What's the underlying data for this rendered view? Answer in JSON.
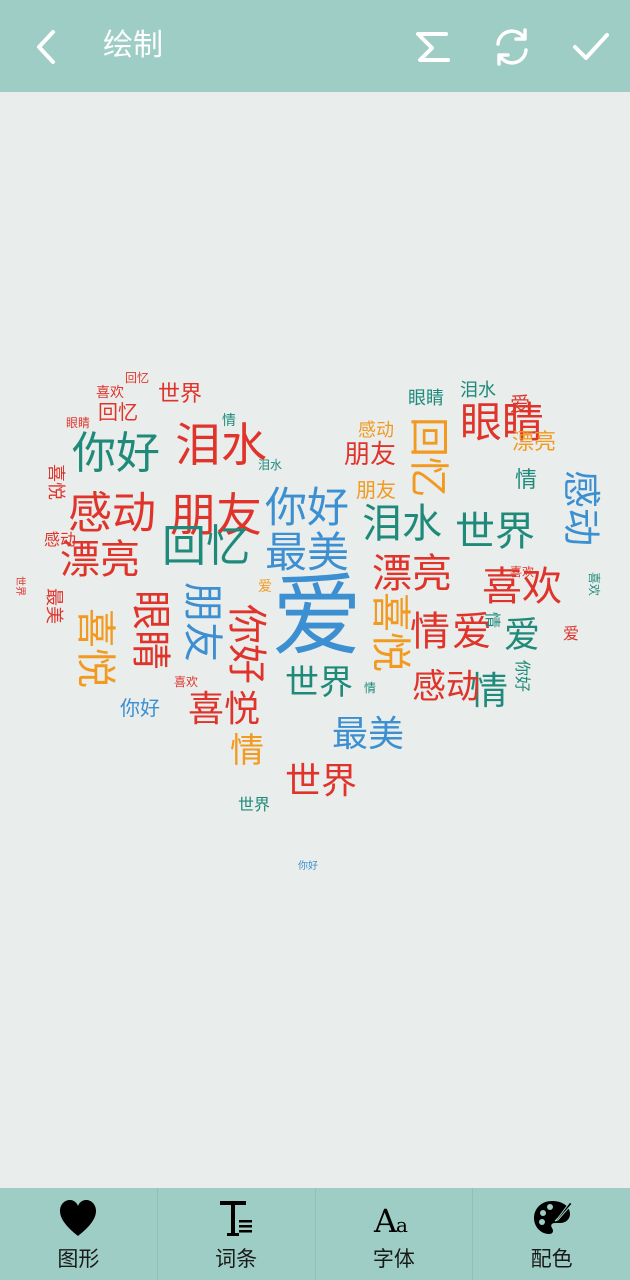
{
  "header": {
    "title": "绘制"
  },
  "colors": {
    "bar": "#9dcdc4",
    "canvas": "#e9edec",
    "palette": [
      "#e0342b",
      "#f29a1f",
      "#3c8fd1",
      "#1f8a7a",
      "#e84c2d"
    ]
  },
  "word_cloud": {
    "words": [
      {
        "text": "爱",
        "color": "#3c8fd1",
        "size": 90
      },
      {
        "text": "朋友",
        "color": "#e0342b",
        "size": 46
      },
      {
        "text": "你好",
        "color": "#3c8fd1",
        "size": 42
      },
      {
        "text": "泪水",
        "color": "#e0342b",
        "size": 46
      },
      {
        "text": "你好",
        "color": "#1f8a7a",
        "size": 44
      },
      {
        "text": "感动",
        "color": "#e0342b",
        "size": 44
      },
      {
        "text": "回忆",
        "color": "#1f8a7a",
        "size": 44
      },
      {
        "text": "最美",
        "color": "#3c8fd1",
        "size": 42
      },
      {
        "text": "漂亮",
        "color": "#e0342b",
        "size": 40
      },
      {
        "text": "世界",
        "color": "#1f8a7a",
        "size": 40
      },
      {
        "text": "泪水",
        "color": "#1f8a7a",
        "size": 40
      },
      {
        "text": "眼睛",
        "color": "#e0342b",
        "size": 42
      },
      {
        "text": "回忆",
        "color": "#f29a1f",
        "size": 40
      },
      {
        "text": "漂亮",
        "color": "#e0342b",
        "size": 40
      },
      {
        "text": "喜欢",
        "color": "#e0342b",
        "size": 40
      },
      {
        "text": "感动",
        "color": "#3c8fd1",
        "size": 38
      },
      {
        "text": "情",
        "color": "#e0342b",
        "size": 40
      },
      {
        "text": "爱",
        "color": "#e0342b",
        "size": 40
      },
      {
        "text": "爱",
        "color": "#1f8a7a",
        "size": 36
      },
      {
        "text": "喜悦",
        "color": "#f29a1f",
        "size": 40
      },
      {
        "text": "眼睛",
        "color": "#e0342b",
        "size": 40
      },
      {
        "text": "朋友",
        "color": "#3c8fd1",
        "size": 40
      },
      {
        "text": "你好",
        "color": "#e0342b",
        "size": 40
      },
      {
        "text": "喜悦",
        "color": "#f29a1f",
        "size": 40
      },
      {
        "text": "情",
        "color": "#1f8a7a",
        "size": 38
      },
      {
        "text": "感动",
        "color": "#e0342b",
        "size": 34
      },
      {
        "text": "世界",
        "color": "#1f8a7a",
        "size": 34
      },
      {
        "text": "最美",
        "color": "#3c8fd1",
        "size": 36
      },
      {
        "text": "喜悦",
        "color": "#e0342b",
        "size": 36
      },
      {
        "text": "情",
        "color": "#f29a1f",
        "size": 34
      },
      {
        "text": "世界",
        "color": "#e0342b",
        "size": 36
      },
      {
        "text": "朋友",
        "color": "#e0342b",
        "size": 26
      },
      {
        "text": "感动",
        "color": "#f29a1f",
        "size": 18
      },
      {
        "text": "漂亮",
        "color": "#f29a1f",
        "size": 22
      },
      {
        "text": "情",
        "color": "#1f8a7a",
        "size": 22
      },
      {
        "text": "朋友",
        "color": "#f29a1f",
        "size": 20
      },
      {
        "text": "眼睛",
        "color": "#1f8a7a",
        "size": 18
      },
      {
        "text": "泪水",
        "color": "#1f8a7a",
        "size": 18
      },
      {
        "text": "爱",
        "color": "#e0342b",
        "size": 20
      },
      {
        "text": "回忆",
        "color": "#e0342b",
        "size": 20
      },
      {
        "text": "世界",
        "color": "#e0342b",
        "size": 22
      },
      {
        "text": "喜欢",
        "color": "#e0342b",
        "size": 14
      },
      {
        "text": "回忆",
        "color": "#e0342b",
        "size": 12
      },
      {
        "text": "眼睛",
        "color": "#e0342b",
        "size": 12
      },
      {
        "text": "情",
        "color": "#1f8a7a",
        "size": 14
      },
      {
        "text": "泪水",
        "color": "#1f8a7a",
        "size": 12
      },
      {
        "text": "喜悦",
        "color": "#e0342b",
        "size": 18
      },
      {
        "text": "最美",
        "color": "#e0342b",
        "size": 18
      },
      {
        "text": "你好",
        "color": "#3c8fd1",
        "size": 20
      },
      {
        "text": "喜欢",
        "color": "#e0342b",
        "size": 12
      },
      {
        "text": "情",
        "color": "#1f8a7a",
        "size": 12
      },
      {
        "text": "世界",
        "color": "#1f8a7a",
        "size": 16
      },
      {
        "text": "你好",
        "color": "#3c8fd1",
        "size": 10
      },
      {
        "text": "感动",
        "color": "#e0342b",
        "size": 16
      },
      {
        "text": "喜欢",
        "color": "#e0342b",
        "size": 12
      },
      {
        "text": "喜欢",
        "color": "#1f8a7a",
        "size": 12
      },
      {
        "text": "爱",
        "color": "#f29a1f",
        "size": 14
      },
      {
        "text": "情",
        "color": "#1f8a7a",
        "size": 16
      },
      {
        "text": "你好",
        "color": "#1f8a7a",
        "size": 16
      },
      {
        "text": "爱",
        "color": "#e0342b",
        "size": 16
      },
      {
        "text": "世界",
        "color": "#e0342b",
        "size": 10
      }
    ]
  },
  "tabs": [
    {
      "label": "图形",
      "icon": "heart-icon"
    },
    {
      "label": "词条",
      "icon": "text-entry-icon"
    },
    {
      "label": "字体",
      "icon": "font-icon"
    },
    {
      "label": "配色",
      "icon": "palette-icon"
    }
  ]
}
